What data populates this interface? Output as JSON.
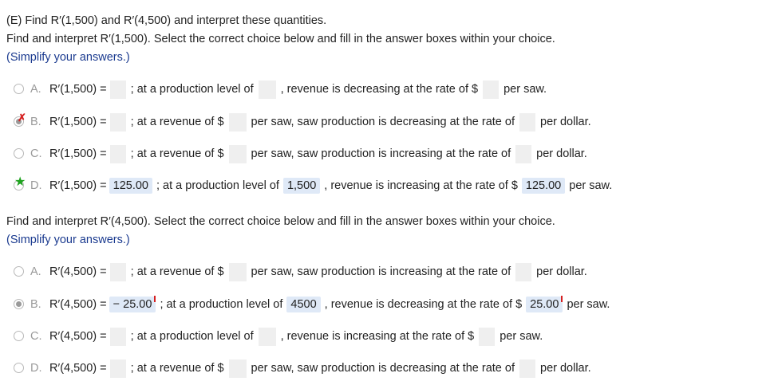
{
  "header": {
    "line1": "(E) Find R′(1,500) and R′(4,500) and interpret these quantities.",
    "line2": "Find and interpret R′(1,500). Select the correct choice below and fill in the answer boxes within your choice.",
    "line3": "(Simplify your answers.)"
  },
  "part1": {
    "choices": [
      {
        "letter": "A.",
        "expr": "R′(1,500) =",
        "t1": "; at a production level of",
        "t2": ", revenue is decreasing at the rate of $",
        "t3": "per saw."
      },
      {
        "letter": "B.",
        "expr": "R′(1,500) =",
        "t1": "; at a revenue of $",
        "t2": "per saw, saw production is decreasing at the rate of",
        "t3": "per dollar."
      },
      {
        "letter": "C.",
        "expr": "R′(1,500) =",
        "t1": "; at a revenue of $",
        "t2": "per saw, saw production is increasing at the rate of",
        "t3": "per dollar."
      },
      {
        "letter": "D.",
        "expr": "R′(1,500) =",
        "a1": "125.00",
        "t1": "; at a production level of",
        "a2": "1,500",
        "t2": ", revenue is increasing at the rate of $",
        "a3": "125.00",
        "t3": "per saw."
      }
    ]
  },
  "section2": {
    "line1": "Find and interpret R′(4,500). Select the correct choice below and fill in the answer boxes within your choice.",
    "line2": "(Simplify your answers.)"
  },
  "part2": {
    "choices": [
      {
        "letter": "A.",
        "expr": "R′(4,500) =",
        "t1": "; at a revenue of $",
        "t2": "per saw, saw production is increasing at the rate of",
        "t3": "per dollar."
      },
      {
        "letter": "B.",
        "expr": "R′(4,500) =",
        "a1": "− 25.00",
        "t1": "; at a production level of",
        "a2": "4500",
        "t2": ", revenue is decreasing at the rate of $",
        "a3": "25.00",
        "t3": "per saw."
      },
      {
        "letter": "C.",
        "expr": "R′(4,500) =",
        "t1": "; at a production level of",
        "t2": ", revenue is increasing at the rate of $",
        "t3": "per saw."
      },
      {
        "letter": "D.",
        "expr": "R′(4,500) =",
        "t1": "; at a revenue of $",
        "t2": "per saw, saw production is decreasing at the rate of",
        "t3": "per dollar."
      }
    ]
  },
  "colors": {
    "incorrect": "#d62020",
    "correct": "#1ea21e",
    "answer_bg": "#dfe9f7",
    "blank_bg": "#efefef"
  }
}
